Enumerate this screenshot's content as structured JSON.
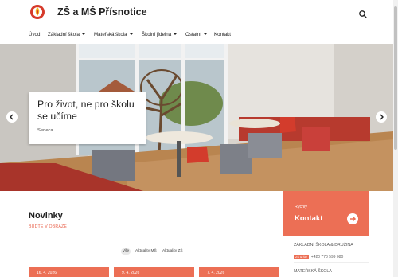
{
  "site": {
    "title": "ZŠ a MŠ Přísnotice"
  },
  "nav": [
    {
      "label": "Úvod",
      "dropdown": false
    },
    {
      "label": "Základní škola",
      "dropdown": true
    },
    {
      "label": "Mateřská škola",
      "dropdown": true
    },
    {
      "label": "Školní jídelna",
      "dropdown": true
    },
    {
      "label": "Ostatní",
      "dropdown": true
    },
    {
      "label": "Kontakt",
      "dropdown": false
    }
  ],
  "hero": {
    "title": "Pro život, ne pro školu se učíme",
    "author": "Seneca"
  },
  "news": {
    "title": "Novinky",
    "subtitle": "BUĎTE V OBRAZE",
    "filters": [
      "Vše",
      "Aktuality MŠ",
      "Aktuality ZŠ"
    ],
    "cards": [
      {
        "date": "16. 4. 2026"
      },
      {
        "date": "9. 4. 2026"
      },
      {
        "date": "7. 4. 2026"
      }
    ]
  },
  "sidebar": {
    "contact_small": "Rychlý",
    "contact_big": "Kontakt",
    "school_label": "ZÁKLADNÍ ŠKOLA & DRUŽINA",
    "phone_badge": "ZŠ & ŠD",
    "phone": "+420 778 599 080",
    "ms_label": "MATEŘSKÁ ŠKOLA"
  },
  "colors": {
    "accent": "#ec6f55",
    "logo_red": "#d63a2a",
    "logo_yellow": "#f2b41b"
  }
}
